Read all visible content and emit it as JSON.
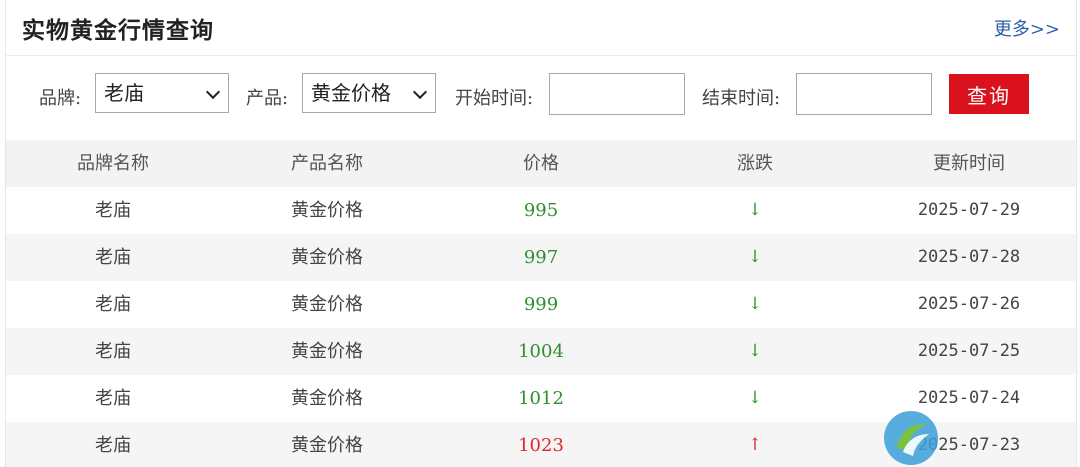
{
  "header": {
    "title": "实物黄金行情查询",
    "more": "更多>>"
  },
  "filters": {
    "brand_label": "品牌:",
    "brand_value": "老庙",
    "product_label": "产品:",
    "product_value": "黄金价格",
    "start_label": "开始时间:",
    "start_value": "",
    "end_label": "结束时间:",
    "end_value": "",
    "query_button": "查询"
  },
  "table": {
    "columns": [
      "品牌名称",
      "产品名称",
      "价格",
      "涨跌",
      "更新时间"
    ],
    "rows": [
      {
        "brand": "老庙",
        "product": "黄金价格",
        "price": "995",
        "trend": "down",
        "arrow": "↓",
        "date": "2025-07-29"
      },
      {
        "brand": "老庙",
        "product": "黄金价格",
        "price": "997",
        "trend": "down",
        "arrow": "↓",
        "date": "2025-07-28"
      },
      {
        "brand": "老庙",
        "product": "黄金价格",
        "price": "999",
        "trend": "down",
        "arrow": "↓",
        "date": "2025-07-26"
      },
      {
        "brand": "老庙",
        "product": "黄金价格",
        "price": "1004",
        "trend": "down",
        "arrow": "↓",
        "date": "2025-07-25"
      },
      {
        "brand": "老庙",
        "product": "黄金价格",
        "price": "1012",
        "trend": "down",
        "arrow": "↓",
        "date": "2025-07-24"
      },
      {
        "brand": "老庙",
        "product": "黄金价格",
        "price": "1023",
        "trend": "up",
        "arrow": "↑",
        "date": "2025-07-23"
      }
    ]
  },
  "colors": {
    "accent": "#d9121e",
    "down": "#2f8f2f",
    "up": "#e0262d",
    "link": "#2a5ea8"
  }
}
